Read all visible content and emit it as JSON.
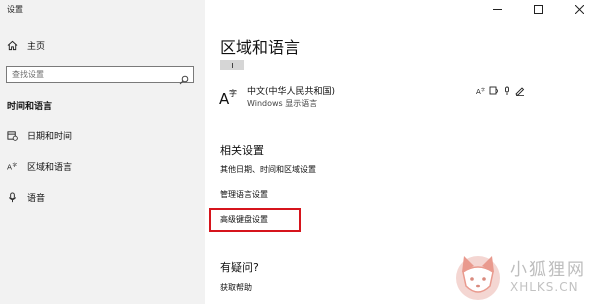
{
  "window": {
    "title": "设置"
  },
  "sidebar": {
    "home_label": "主页",
    "search_placeholder": "查找设置",
    "section_header": "时间和语言",
    "items": [
      {
        "label": "日期和时间",
        "icon": "calendar-clock-icon"
      },
      {
        "label": "区域和语言",
        "icon": "language-icon"
      },
      {
        "label": "语音",
        "icon": "microphone-icon"
      }
    ]
  },
  "main": {
    "title": "区域和语言",
    "language": {
      "name": "中文(中华人民共和国)",
      "sub": "Windows 显示语言"
    },
    "related_header": "相关设置",
    "links": [
      "其他日期、时间和区域设置",
      "管理语言设置",
      "高级键盘设置"
    ],
    "highlighted_link_index": 2,
    "question_header": "有疑问?",
    "help_link": "获取帮助"
  },
  "watermark": {
    "cn": "小狐狸网",
    "en": "XHLKS.CN"
  },
  "colors": {
    "sidebar_bg": "#f2f2f2",
    "highlight_border": "#d6141c"
  }
}
